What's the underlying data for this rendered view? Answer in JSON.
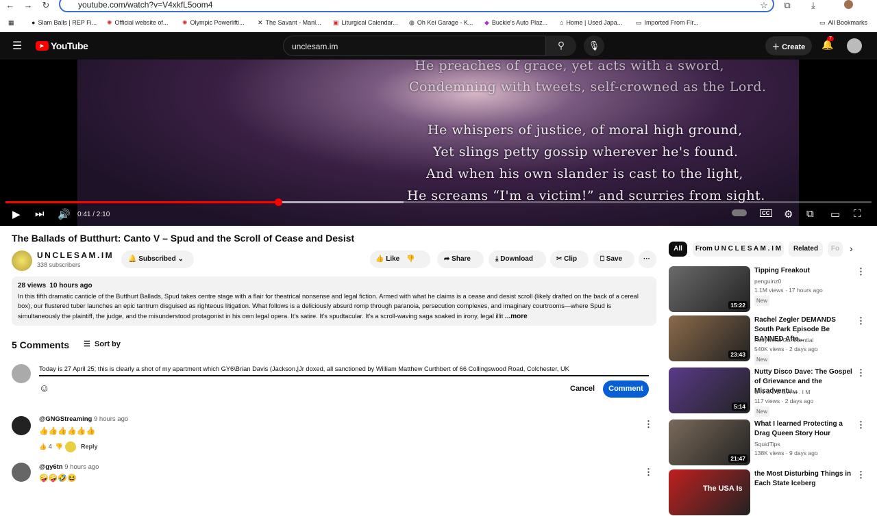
{
  "browser": {
    "url": "youtube.com/watch?v=V4xkfL5oom4",
    "bookmarks": [
      "Slam Balls | REP Fi...",
      "Official website of...",
      "Olympic Powerlifti...",
      "The Savant - Manl...",
      "Liturgical Calendar...",
      "Oh Kei Garage - K...",
      "Buckie's Auto Plaz...",
      "Home | Used Japa...",
      "Imported From Fir..."
    ],
    "all_bookmarks": "All Bookmarks"
  },
  "header": {
    "logo": "YouTube",
    "search_value": "unclesam.im",
    "create": "Create",
    "notif_count": "7"
  },
  "player": {
    "lyrics": [
      "He preaches of grace, yet acts with a sword,",
      "Condemning with tweets, self-crowned as the Lord.",
      "He whispers of justice, of moral high ground,",
      "Yet slings petty gossip wherever he's found.",
      "And when his own slander is cast to the light,",
      "He screams “I'm a victim!” and scurries from sight."
    ],
    "time": "0:41 / 2:10",
    "progress": 0.315,
    "buffered": 0.46,
    "cc": "CC"
  },
  "video": {
    "title": "The Ballads of Butthurt: Canto V – Spud and the Scroll of Cease and Desist",
    "channel": "UNCLESAM.IM",
    "subscribers": "338 subscribers",
    "subscribed": "Subscribed",
    "like": "Like",
    "share": "Share",
    "download": "Download",
    "clip": "Clip",
    "save": "Save",
    "views": "28 views",
    "age": "10 hours ago",
    "description": "In this fifth dramatic canticle of the Butthurt Ballads, Spud takes centre stage with a flair for theatrical nonsense and legal fiction. Armed with what he claims is a cease and desist scroll (likely drafted on the back of a cereal box), our flustered tuber launches an epic tantrum disguised as righteous litigation. What follows is a deliciously absurd romp through paranoia, persecution complexes, and imaginary courtrooms—where Spud is simultaneously the plaintiff, the judge, and the misunderstood protagonist in his own legal opera. It's satire. It's spudtacular. It's a scroll-waving saga soaked in irony, legal illit",
    "more": "...more"
  },
  "comments": {
    "count": "5 Comments",
    "sort": "Sort by",
    "draft": "Today is 27 April 25; this is clearly a shot of my apartment which GY6\\Brian Davis (Jackson,|Jr doxed, all sanctioned by William Matthew Curthbert of 66 Collingswood Road, Colchester, UK",
    "cancel": "Cancel",
    "submit": "Comment",
    "reply": "Reply",
    "items": [
      {
        "user": "@GNGStreaming",
        "time": "9 hours ago",
        "text": "👍👍👍👍👍👍",
        "likes": "4"
      },
      {
        "user": "@gy6tn",
        "time": "9 hours ago",
        "text": "🤪🤪🤣😆"
      }
    ]
  },
  "chips": [
    "All",
    "From U N C L E S A M . I M",
    "Related",
    "Fo"
  ],
  "recommended": [
    {
      "title": "Tipping Freakout",
      "channel": "penguinz0",
      "meta": "1.1M views · 17 hours ago",
      "badge": "New",
      "duration": "15:22",
      "color": "#6a6a6a"
    },
    {
      "title": "Rachel Zegler DEMANDS South Park Episode Be BANNED Afte...",
      "channel": "Hollywood Confidential",
      "meta": "540K views · 2 days ago",
      "badge": "New",
      "duration": "23:43",
      "color": "#8a6a4a"
    },
    {
      "title": "Nutty Disco Dave: The Gospel of Grievance and the Misadventu...",
      "channel": "U N C L E S A M . I M",
      "meta": "117 views · 2 days ago",
      "badge": "New",
      "duration": "5:14",
      "color": "#5a3a8a"
    },
    {
      "title": "What I learned Protecting a Drag Queen Story Hour",
      "channel": "SquidTips",
      "meta": "138K views · 9 days ago",
      "duration": "21:47",
      "color": "#7a6a5a"
    },
    {
      "title": "the Most Disturbing Things in Each State Iceberg",
      "thumb_text": "The USA Is",
      "color": "#c02020"
    }
  ]
}
